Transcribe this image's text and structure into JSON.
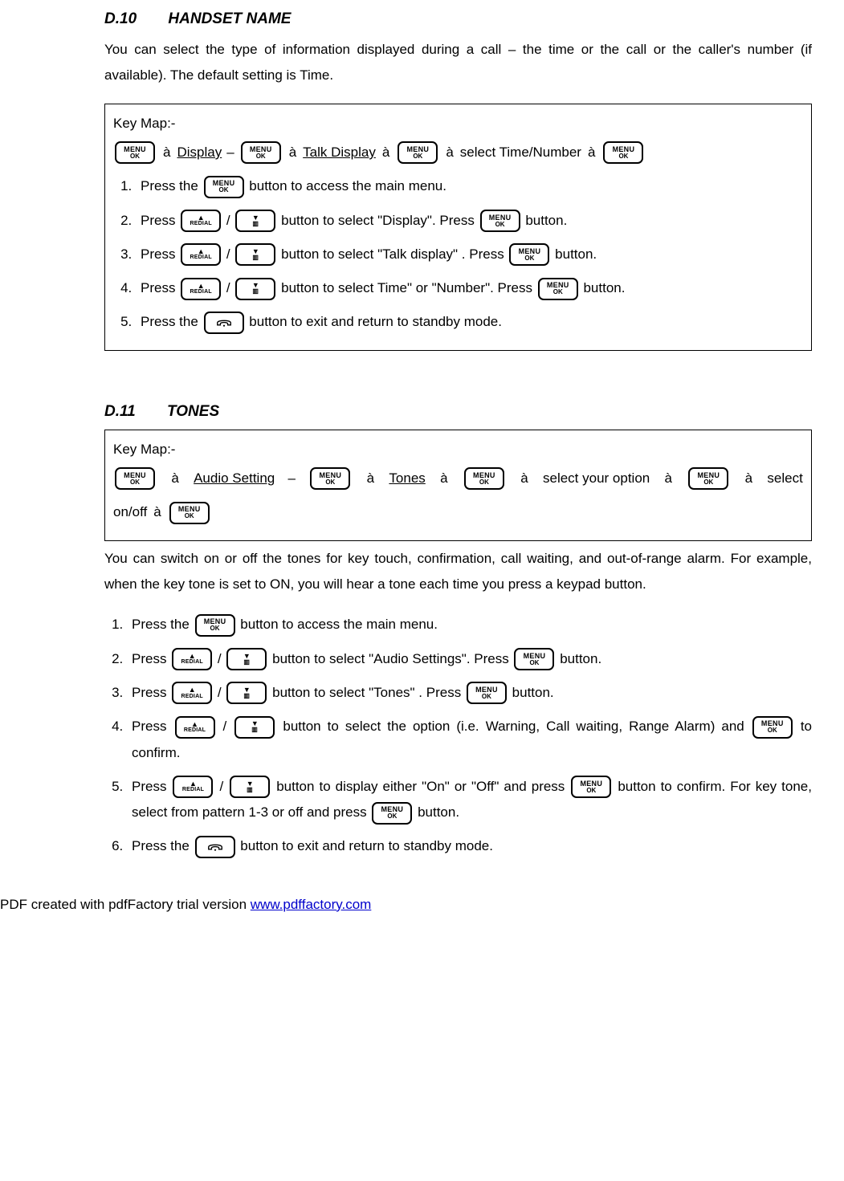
{
  "sec1": {
    "num": "D.10",
    "title": "HANDSET NAME",
    "intro": "You can select the type of information displayed during a call – the time or the call or the caller's number (if available). The default setting is Time.",
    "keymap_label": "Key Map:-",
    "km": {
      "display": "Display",
      "dash": "–",
      "talk_display": "Talk Display",
      "select": "select Time/Number"
    },
    "steps": {
      "s1a": "Press the ",
      "s1b": " button to access the main menu.",
      "s2a": "Press ",
      "s2b": " button to select \"Display\". Press ",
      "s2c": " button.",
      "s3a": "Press ",
      "s3b": " button to select \"Talk display\" . Press ",
      "s3c": " button.",
      "s4a": "Press ",
      "s4b": " button to select Time\" or \"Number\". Press ",
      "s4c": " button.",
      "s5a": "Press the ",
      "s5b": " button to exit and return to standby mode."
    }
  },
  "sec2": {
    "num": "D.11",
    "title": "TONES",
    "keymap_label": "Key Map:-",
    "km": {
      "audio": "Audio Setting",
      "dash": "–",
      "tones": "Tones",
      "select_opt": "select your option",
      "select_onoff": "select on/off"
    },
    "intro": "You can switch on or off the tones for key touch, confirmation, call waiting, and out-of-range alarm. For example, when the key tone is set to ON, you will hear a tone each time you press a keypad button.",
    "steps": {
      "s1a": "Press the ",
      "s1b": " button to access the main menu.",
      "s2a": "Press ",
      "s2b": " button to select \"Audio Settings\". Press ",
      "s2c": " button.",
      "s3a": "Press ",
      "s3b": " button to select \"Tones\" . Press ",
      "s3c": " button.",
      "s4a": "Press ",
      "s4b": " button to select the option (i.e. Warning, Call waiting, Range Alarm) and ",
      "s4c": " to confirm.",
      "s5a": "Press ",
      "s5b": " button to display either \"On\" or \"Off\" and press ",
      "s5c": " button to confirm. For key tone, select from pattern 1-3 or off and press ",
      "s5d": " button.",
      "s6a": "Press the ",
      "s6b": " button to exit and return to standby mode."
    }
  },
  "buttons": {
    "menu_top": "MENU",
    "menu_bot": "OK",
    "redial": "REDIAL"
  },
  "arrow": "à",
  "slash": " / ",
  "footer": {
    "text": "PDF created with pdfFactory trial version ",
    "link": "www.pdffactory.com"
  }
}
